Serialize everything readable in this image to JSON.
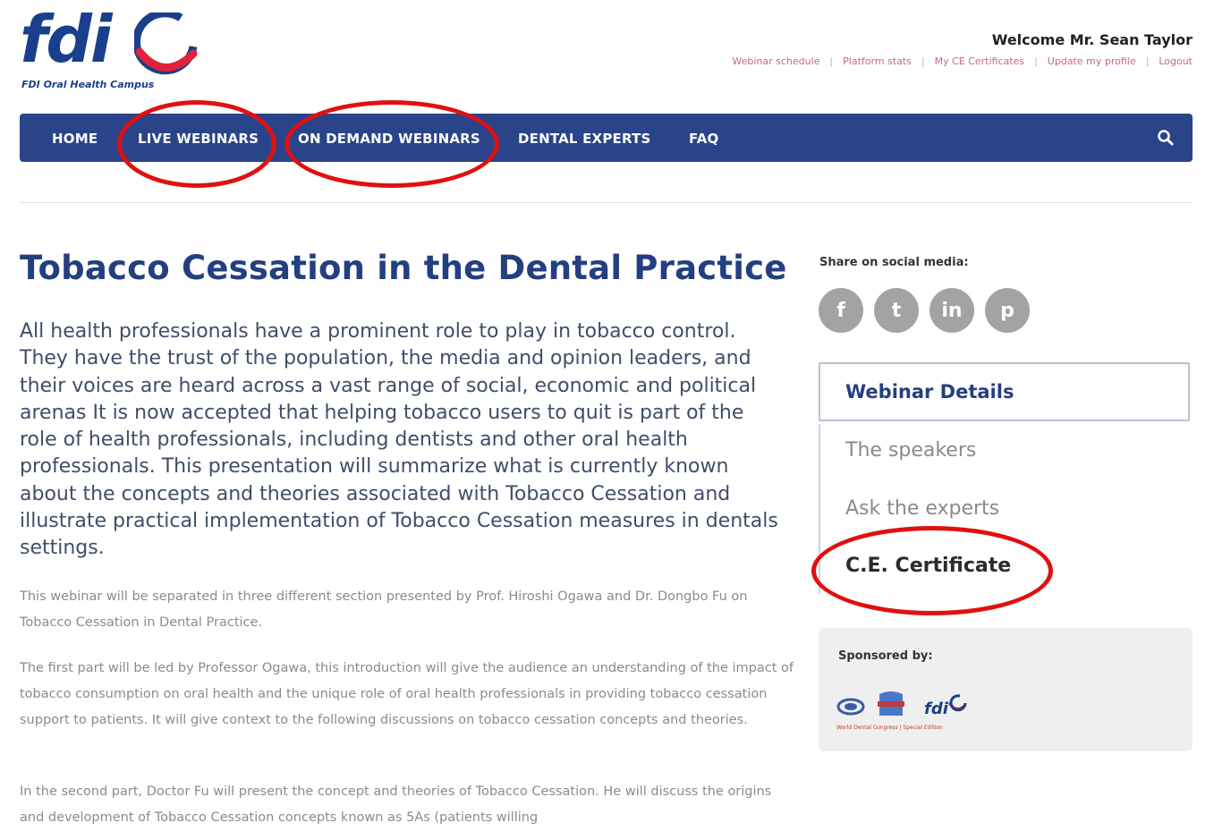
{
  "logo": {
    "word": "fdi",
    "subtitle": "FDI Oral Health Campus"
  },
  "header": {
    "welcome": "Welcome Mr. Sean Taylor",
    "links": [
      "Webinar schedule",
      "Platform stats",
      "My CE Certificates",
      "Update my profile",
      "Logout"
    ]
  },
  "nav": {
    "items": [
      "HOME",
      "LIVE WEBINARS",
      "ON DEMAND WEBINARS",
      "DENTAL EXPERTS",
      "FAQ"
    ],
    "search_icon": "search-icon",
    "color": "#2a448a"
  },
  "main": {
    "title": "Tobacco Cessation in the Dental Practice",
    "lead": "All health professionals have a prominent role to play in tobacco control. They have the trust of the population, the media and opinion leaders, and their voices are heard across a vast range of social, economic and political arenas It is now accepted that helping tobacco users to quit is part of the role of health professionals, including dentists and other oral health professionals. This presentation will summarize what is currently known about the concepts and theories associated with Tobacco Cessation and illustrate practical implementation of Tobacco Cessation measures in dentals settings.",
    "paragraphs": [
      "This webinar will be separated in three different section presented by Prof. Hiroshi Ogawa and Dr. Dongbo Fu on Tobacco Cessation in Dental Practice.",
      "The first part will be led by Professor Ogawa, this introduction will give the audience an understanding of the impact of tobacco consumption on oral health and the unique role of oral health professionals in providing tobacco cessation support to patients.  It will give context to the following discussions on tobacco cessation concepts and theories.",
      "In the second part, Doctor Fu will present the concept and theories of Tobacco Cessation. He will discuss the origins and development of Tobacco Cessation concepts known as 5As (patients willing"
    ]
  },
  "sidebar": {
    "share_label": "Share on social media:",
    "social": [
      {
        "icon": "facebook-icon",
        "glyph": "f"
      },
      {
        "icon": "twitter-icon",
        "glyph": "t"
      },
      {
        "icon": "linkedin-icon",
        "glyph": "in"
      },
      {
        "icon": "pinterest-icon",
        "glyph": "p"
      }
    ],
    "details_title": "Webinar Details",
    "details_links": [
      "The speakers",
      "Ask the experts",
      "C.E. Certificate"
    ],
    "sponsor_label": "Sponsored by:",
    "sponsor_caption": "World Dental Congress | Special Edition"
  },
  "colors": {
    "brand": "#1a3f8c",
    "accent": "#e0223a",
    "annotation": "#e11010"
  }
}
